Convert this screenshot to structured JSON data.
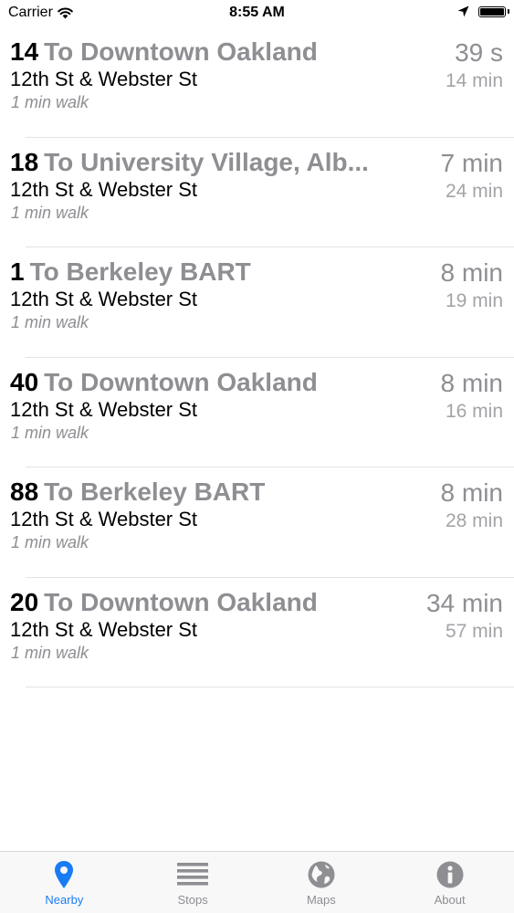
{
  "status_bar": {
    "carrier": "Carrier",
    "time": "8:55 AM",
    "icons": [
      "wifi-icon",
      "location-arrow-icon",
      "battery-icon"
    ]
  },
  "arrivals": [
    {
      "route": "14",
      "destination": "To Downtown Oakland",
      "stop": "12th St & Webster St",
      "walk": "1 min walk",
      "eta": "39 s",
      "next_eta": "14 min"
    },
    {
      "route": "18",
      "destination": "To University Village, Alb...",
      "stop": "12th St & Webster St",
      "walk": "1 min walk",
      "eta": "7 min",
      "next_eta": "24 min"
    },
    {
      "route": "1",
      "destination": "To Berkeley BART",
      "stop": "12th St & Webster St",
      "walk": "1 min walk",
      "eta": "8 min",
      "next_eta": "19 min"
    },
    {
      "route": "40",
      "destination": "To Downtown Oakland",
      "stop": "12th St & Webster St",
      "walk": "1 min walk",
      "eta": "8 min",
      "next_eta": "16 min"
    },
    {
      "route": "88",
      "destination": "To Berkeley BART",
      "stop": "12th St & Webster St",
      "walk": "1 min walk",
      "eta": "8 min",
      "next_eta": "28 min"
    },
    {
      "route": "20",
      "destination": "To Downtown Oakland",
      "stop": "12th St & Webster St",
      "walk": "1 min walk",
      "eta": "34 min",
      "next_eta": "57 min"
    }
  ],
  "tab_bar": {
    "tabs": [
      {
        "label": "Nearby",
        "icon": "map-pin-icon",
        "active": true
      },
      {
        "label": "Stops",
        "icon": "list-icon",
        "active": false
      },
      {
        "label": "Maps",
        "icon": "globe-icon",
        "active": false
      },
      {
        "label": "About",
        "icon": "info-icon",
        "active": false
      }
    ]
  },
  "colors": {
    "accent": "#1a7cf5",
    "secondary_text": "#8e8e93",
    "tab_inactive": "#8e8e93"
  }
}
